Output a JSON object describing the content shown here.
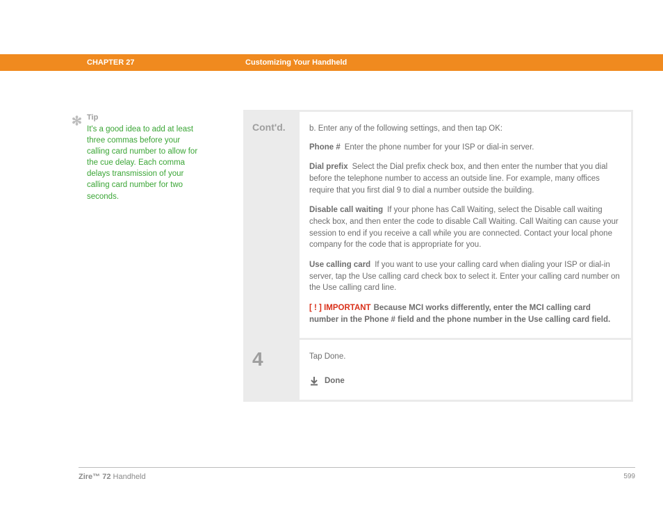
{
  "header": {
    "chapter": "CHAPTER 27",
    "title": "Customizing Your Handheld"
  },
  "tip": {
    "heading": "Tip",
    "text": "It's a good idea to add at least three commas before your calling card number to allow for the cue delay. Each comma delays transmission of your calling card number for two seconds."
  },
  "step_contd": {
    "label": "Cont'd.",
    "intro": "b.  Enter any of the following settings, and then tap OK:",
    "phone_label": "Phone #",
    "phone_text": "Enter the phone number for your ISP or dial-in server.",
    "dialprefix_label": "Dial prefix",
    "dialprefix_text": "Select the Dial prefix check box, and then enter the number that you dial before the telephone number to access an outside line. For example, many offices require that you first dial 9 to dial a number outside the building.",
    "disable_label": "Disable call waiting",
    "disable_text": "If your phone has Call Waiting, select the Disable call waiting check box, and then enter the code to disable Call Waiting. Call Waiting can cause your session to end if you receive a call while you are connected. Contact your local phone company for the code that is appropriate for you.",
    "calling_label": "Use calling card",
    "calling_text": "If you want to use your calling card when dialing your ISP or dial-in server, tap the Use calling card check box to select it. Enter your calling card number on the Use calling card line.",
    "important_flag": "[ ! ] IMPORTANT",
    "important_text": "Because MCI works differently, enter the MCI calling card number in the Phone # field and the phone number in the Use calling card field."
  },
  "step4": {
    "num": "4",
    "text": "Tap Done.",
    "done": "Done"
  },
  "footer": {
    "product_bold": "Zire™ 72",
    "product_rest": " Handheld",
    "page": "599"
  }
}
